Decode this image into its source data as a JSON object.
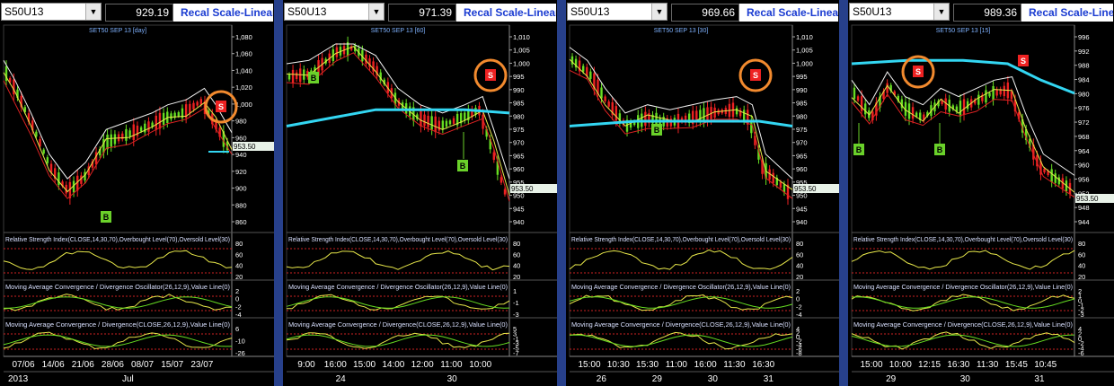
{
  "colors": {
    "panel_bg": "#000000",
    "separator": "#27408b",
    "ma_slow": "#33d6f2",
    "price_up": "#66dd22",
    "price_down": "#ee2222",
    "buy_marker": "#6ad12a",
    "sell_marker": "#ee2222",
    "highlight_circle": "#f28a2e",
    "recal_text": "#1a3bd1"
  },
  "icons": {
    "dropdown": "chevron-down-icon",
    "sell": "S",
    "buy": "B"
  },
  "indicators": {
    "rsi": "Relative Strength Index(CLOSE,14,30,70),Overbought Level(70),Oversold Level(30)",
    "macd_osc": "Moving Average Convergence / Divergence Oscillator(26,12,9),Value Line(0)",
    "macd": "Moving Average Convergence / Divergence(CLOSE,26,12,9),Value Line(0)"
  },
  "panels": [
    {
      "symbol": "S50U13",
      "price": "929.19",
      "recal": "Recal Scale-Linear",
      "chart_title": "SET50 SEP 13  [day]",
      "price_ticks": [
        "1,080",
        "1,060",
        "1,040",
        "1,020",
        "1,000",
        "980",
        "960",
        "940",
        "920",
        "900",
        "880",
        "860"
      ],
      "current_price_label": "953.50",
      "rsi_ticks": [
        "80",
        "60",
        "40",
        "20"
      ],
      "osc_ticks": [
        "2",
        "0",
        "-2",
        "-4"
      ],
      "macd_ticks": [
        "6",
        "-10",
        "-26"
      ],
      "x_labels": [
        "07/06",
        "14/06",
        "21/06",
        "28/06",
        "08/07",
        "15/07",
        "23/07"
      ],
      "x_labels2": [
        "2013",
        "Jul"
      ]
    },
    {
      "symbol": "S50U13",
      "price": "971.39",
      "recal": "Recal Scale-Linear",
      "chart_title": "SET50 SEP 13  [60]",
      "price_ticks": [
        "1,010",
        "1,005",
        "1,000",
        "995",
        "990",
        "985",
        "980",
        "975",
        "970",
        "965",
        "960",
        "955",
        "950",
        "945",
        "940"
      ],
      "current_price_label": "953.50",
      "rsi_ticks": [
        "80",
        "60",
        "40",
        "20"
      ],
      "osc_ticks": [
        "1",
        "-1",
        "-3"
      ],
      "macd_ticks": [
        "5",
        "3",
        "-1",
        "-3",
        "-5",
        "-7"
      ],
      "x_labels": [
        "9:00",
        "16:00",
        "15:00",
        "14:00",
        "12:00",
        "11:00",
        "10:00"
      ],
      "x_labels2": [
        "24",
        "30"
      ]
    },
    {
      "symbol": "S50U13",
      "price": "969.66",
      "recal": "Recal Scale-Linear",
      "chart_title": "SET50 SEP 13  [30]",
      "price_ticks": [
        "1,010",
        "1,005",
        "1,000",
        "995",
        "990",
        "985",
        "980",
        "975",
        "970",
        "965",
        "960",
        "955",
        "950",
        "945",
        "940"
      ],
      "current_price_label": "953.50",
      "rsi_ticks": [
        "80",
        "60",
        "40",
        "20"
      ],
      "osc_ticks": [
        "2",
        "0",
        "-2",
        "-4"
      ],
      "macd_ticks": [
        "4",
        "2",
        "0",
        "-2",
        "-4",
        "-6",
        "-8"
      ],
      "x_labels": [
        "15:00",
        "10:30",
        "15:30",
        "11:00",
        "16:00",
        "11:30",
        "16:30"
      ],
      "x_labels2": [
        "26",
        "29",
        "30",
        "31"
      ]
    },
    {
      "symbol": "S50U13",
      "price": "989.36",
      "recal": "Recal Scale-Linear",
      "chart_title": "SET50 SEP 13  [15]",
      "price_ticks": [
        "996",
        "992",
        "988",
        "984",
        "980",
        "976",
        "972",
        "968",
        "964",
        "960",
        "956",
        "952",
        "948",
        "944"
      ],
      "current_price_label": "953.50",
      "rsi_ticks": [
        "80",
        "60",
        "40",
        "20"
      ],
      "osc_ticks": [
        "2",
        "1",
        "0",
        "-1",
        "-2",
        "-3"
      ],
      "macd_ticks": [
        "4",
        "2",
        "0",
        "-2",
        "-4",
        "-6"
      ],
      "x_labels": [
        "15:00",
        "10:00",
        "12:15",
        "16:30",
        "11:30",
        "15:45",
        "10:45"
      ],
      "x_labels2": [
        "29",
        "30",
        "31"
      ]
    }
  ]
}
